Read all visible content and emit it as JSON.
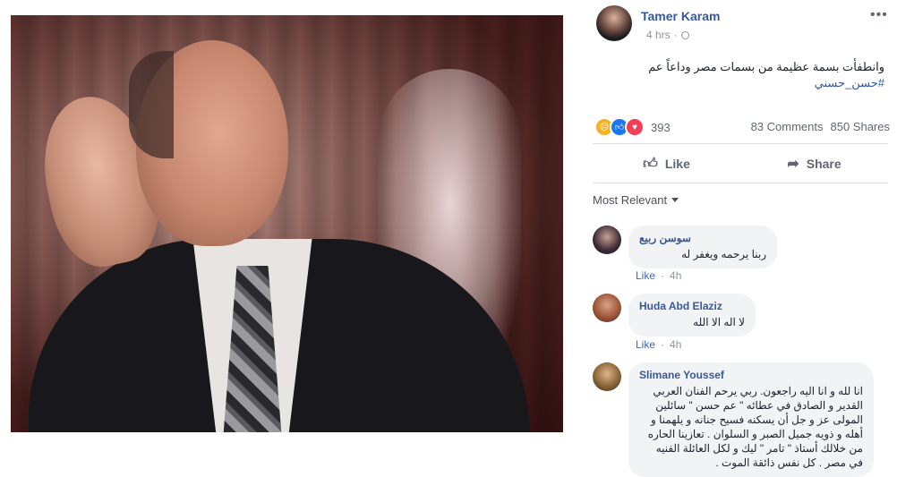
{
  "post": {
    "author_name": "Tamer Karam",
    "time": "4 hrs",
    "time_separator": "·",
    "more_icon": "ellipsis-icon",
    "text_before_hashtag": "وانطفأت بسمة عظيمة من بسمات مصر وداعاً عم ",
    "hashtag": "#حسن_حسني",
    "reaction_count": "393",
    "comments_count": "83 Comments",
    "shares_count": "850 Shares",
    "like_label": "Like",
    "share_label": "Share",
    "sort_label": "Most Relevant"
  },
  "colors": {
    "link": "#365899",
    "like_blue": "#1877f2",
    "love_red": "#f33e58",
    "sad_yellow": "#f7b125"
  },
  "comments": [
    {
      "name": "سوسن ربيع",
      "text": "ربنا يرحمه ويغفر له",
      "like": "Like",
      "dot": "·",
      "time": "4h"
    },
    {
      "name": "Huda Abd Elaziz",
      "text": "لا اله الا الله",
      "like": "Like",
      "dot": "·",
      "time": "4h"
    },
    {
      "name": "Slimane Youssef",
      "text": "انا لله و انا اليه راجعون. ربي يرحم الفنان العربي القدير و الصادق في عطائه \" عم حسن \" سائلين المولى عز و جل أن يسكنه فسيح جنانه و يلهمنا و أهله و ذويه جميل الصبر و السلوان . تعازينا الحاره من خلالك أستاذ \" تامر \" ليك و لكل العائلة الفنيه في مصر . كل نفس ذائقة الموت ."
    }
  ]
}
